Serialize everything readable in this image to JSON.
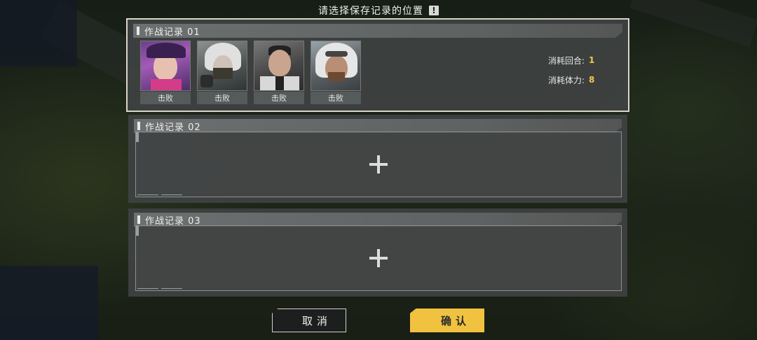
{
  "dialog": {
    "title": "请选择保存记录的位置",
    "info_glyph": "!"
  },
  "slots": [
    {
      "label": "作战记录 01",
      "filled": true,
      "characters": [
        {
          "status": "击败",
          "icon": "character-portrait-purple-hair"
        },
        {
          "status": "击败",
          "icon": "character-portrait-white-hair-mask"
        },
        {
          "status": "击败",
          "icon": "character-portrait-suited-man"
        },
        {
          "status": "击败",
          "icon": "character-portrait-hooded-goggles"
        }
      ],
      "stats": [
        {
          "label": "消耗回合:",
          "value": "1"
        },
        {
          "label": "消耗体力:",
          "value": "8"
        }
      ]
    },
    {
      "label": "作战记录 02",
      "filled": false,
      "plus_icon": "plus-icon"
    },
    {
      "label": "作战记录 03",
      "filled": false,
      "plus_icon": "plus-icon"
    }
  ],
  "buttons": {
    "cancel_label": "取消",
    "confirm_label": "确认"
  },
  "colors": {
    "accent": "#f0c23f",
    "panel": "#3e4242",
    "stat_value": "#f2c94c"
  }
}
